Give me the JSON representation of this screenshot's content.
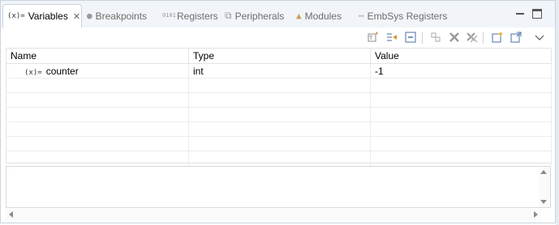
{
  "tabs": [
    {
      "icon": "(x)=",
      "label": "Variables",
      "active": true
    },
    {
      "icon": "●",
      "label": "Breakpoints"
    },
    {
      "icon": "0101",
      "label": "Registers"
    },
    {
      "icon": "⧉",
      "label": "Peripherals"
    },
    {
      "icon": "▲",
      "label": "Modules"
    },
    {
      "icon": "⋯",
      "label": "EmbSys Registers"
    }
  ],
  "table": {
    "columns": [
      "Name",
      "Type",
      "Value"
    ],
    "rows": [
      {
        "icon": "(x)=",
        "name": "counter",
        "type": "int",
        "value": "-1"
      }
    ]
  },
  "toolbar": {
    "buttons": [
      "show-type-names-icon",
      "show-logical-structure-icon",
      "collapse-all-icon",
      "link-icon",
      "remove-icon",
      "remove-all-icon",
      "new-view-icon",
      "pin-icon",
      "view-menu-icon"
    ]
  },
  "colors": {
    "tab_bar_bg": "#f1f4f8",
    "border": "#c9d3dd"
  }
}
